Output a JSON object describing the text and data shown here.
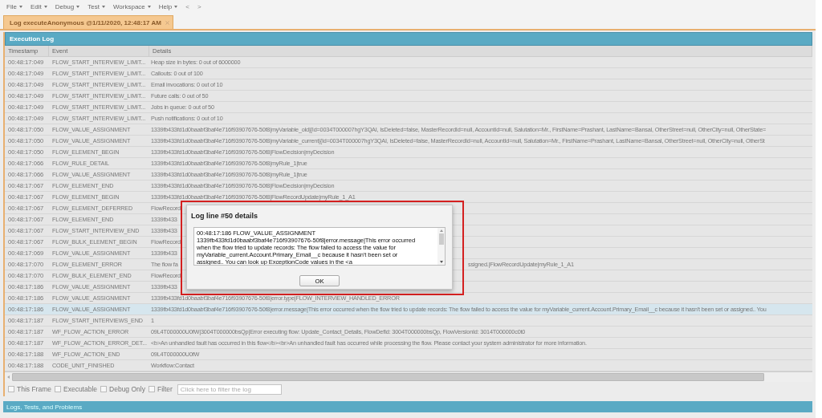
{
  "menu": [
    {
      "label": "File"
    },
    {
      "label": "Edit"
    },
    {
      "label": "Debug"
    },
    {
      "label": "Test"
    },
    {
      "label": "Workspace"
    },
    {
      "label": "Help"
    }
  ],
  "nav_buttons": [
    {
      "label": "<",
      "disabled": true
    },
    {
      "label": ">",
      "disabled": true
    }
  ],
  "tab": {
    "label": "Log executeAnonymous @1/11/2020, 12:48:17 AM",
    "selected": true
  },
  "panel": {
    "title": "Execution Log"
  },
  "table": {
    "columns": [
      "Timestamp",
      "Event",
      "Details"
    ],
    "rows": [
      {
        "timestamp": "00:48:17:049",
        "event": "FLOW_START_INTERVIEW_LIMIT...",
        "details": "Heap size in bytes: 0 out of 6000000",
        "selected": false
      },
      {
        "timestamp": "00:48:17:049",
        "event": "FLOW_START_INTERVIEW_LIMIT...",
        "details": "Callouts: 0 out of 100",
        "selected": false
      },
      {
        "timestamp": "00:48:17:049",
        "event": "FLOW_START_INTERVIEW_LIMIT...",
        "details": "Email invocations: 0 out of 10",
        "selected": false
      },
      {
        "timestamp": "00:48:17:049",
        "event": "FLOW_START_INTERVIEW_LIMIT...",
        "details": "Future calls: 0 out of 50",
        "selected": false
      },
      {
        "timestamp": "00:48:17:049",
        "event": "FLOW_START_INTERVIEW_LIMIT...",
        "details": "Jobs in queue: 0 out of 50",
        "selected": false
      },
      {
        "timestamp": "00:48:17:049",
        "event": "FLOW_START_INTERVIEW_LIMIT...",
        "details": "Push notifications: 0 out of 10",
        "selected": false
      },
      {
        "timestamp": "00:48:17:050",
        "event": "FLOW_VALUE_ASSIGNMENT",
        "details": "1339fb433fd1d0baabf3baf4e716f93907676-50f8|myVariable_old|{Id=0034T000007hgY3QAI, IsDeleted=false, MasterRecordId=null, AccountId=null, Salutation=Mr., FirstName=Prashant, LastName=Bansal, OtherStreet=null, OtherCity=null, OtherState=",
        "selected": false
      },
      {
        "timestamp": "00:48:17:050",
        "event": "FLOW_VALUE_ASSIGNMENT",
        "details": "1339fb433fd1d0baabf3baf4e716f93907676-50f8|myVariable_current|{Id=0034T000007hgY3QAI, IsDeleted=false, MasterRecordId=null, AccountId=null, Salutation=Mr., FirstName=Prashant, LastName=Bansal, OtherStreet=null, OtherCity=null, OtherSt",
        "selected": false
      },
      {
        "timestamp": "00:48:17:050",
        "event": "FLOW_ELEMENT_BEGIN",
        "details": "1339fb433fd1d0baabf3baf4e716f93907676-50f8|FlowDecision|myDecision",
        "selected": false
      },
      {
        "timestamp": "00:48:17:066",
        "event": "FLOW_RULE_DETAIL",
        "details": "1339fb433fd1d0baabf3baf4e716f93907676-50f8|myRule_1|true",
        "selected": false
      },
      {
        "timestamp": "00:48:17:066",
        "event": "FLOW_VALUE_ASSIGNMENT",
        "details": "1339fb433fd1d0baabf3baf4e716f93907676-50f8|myRule_1|true",
        "selected": false
      },
      {
        "timestamp": "00:48:17:067",
        "event": "FLOW_ELEMENT_END",
        "details": "1339fb433fd1d0baabf3baf4e716f93907676-50f8|FlowDecision|myDecision",
        "selected": false
      },
      {
        "timestamp": "00:48:17:067",
        "event": "FLOW_ELEMENT_BEGIN",
        "details": "1339fb433fd1d0baabf3baf4e716f93907676-50f8|FlowRecordUpdate|myRule_1_A1",
        "selected": false
      },
      {
        "timestamp": "00:48:17:067",
        "event": "FLOW_ELEMENT_DEFERRED",
        "details": "FlowRecord",
        "selected": false
      },
      {
        "timestamp": "00:48:17:067",
        "event": "FLOW_ELEMENT_END",
        "details": "1339fb433",
        "selected": false
      },
      {
        "timestamp": "00:48:17:067",
        "event": "FLOW_START_INTERVIEW_END",
        "details": "1339fb433",
        "selected": false
      },
      {
        "timestamp": "00:48:17:067",
        "event": "FLOW_BULK_ELEMENT_BEGIN",
        "details": "FlowRecord",
        "selected": false
      },
      {
        "timestamp": "00:48:17:069",
        "event": "FLOW_VALUE_ASSIGNMENT",
        "details": "1339fb433",
        "selected": false
      },
      {
        "timestamp": "00:48:17:070",
        "event": "FLOW_ELEMENT_ERROR",
        "details": "The flow fa",
        "details_tail": "ssigned.|FlowRecordUpdate|myRule_1_A1",
        "selected": false
      },
      {
        "timestamp": "00:48:17:070",
        "event": "FLOW_BULK_ELEMENT_END",
        "details": "FlowRecord",
        "selected": false
      },
      {
        "timestamp": "00:48:17:186",
        "event": "FLOW_VALUE_ASSIGNMENT",
        "details": "1339fb433",
        "selected": false
      },
      {
        "timestamp": "00:48:17:186",
        "event": "FLOW_VALUE_ASSIGNMENT",
        "details": "1339fb433fd1d0baabf3baf4e716f93907676-50f8|error.type|FLOW_INTERVIEW_HANDLED_ERROR",
        "selected": false
      },
      {
        "timestamp": "00:48:17:186",
        "event": "FLOW_VALUE_ASSIGNMENT",
        "details": "1339fb433fd1d0baabf3baf4e716f93907676-50f8|error.message|This error occurred when the flow tried to update records: The flow failed to access the value for myVariable_current.Account.Primary_Email__c because it hasn't been set or assigned.. You",
        "selected": true
      },
      {
        "timestamp": "00:48:17:187",
        "event": "FLOW_START_INTERVIEWS_END",
        "details": "1",
        "selected": false
      },
      {
        "timestamp": "00:48:17:187",
        "event": "WF_FLOW_ACTION_ERROR",
        "details": "09L4T000000U0fW|3004T000000bsQp|Error executing flow: Update_Contact_Details, FlowDefId: 3004T000000bsQp, FlowVersionId: 3014T000000c0t0",
        "selected": false
      },
      {
        "timestamp": "00:48:17:187",
        "event": "WF_FLOW_ACTION_ERROR_DET...",
        "details": "<b>An unhandled fault has occurred in this flow</b><br>An unhandled fault has occurred while processing the flow. Please contact your system administrator for more information.",
        "selected": false
      },
      {
        "timestamp": "00:48:17:188",
        "event": "WF_FLOW_ACTION_END",
        "details": "09L4T000000U0fW",
        "selected": false
      },
      {
        "timestamp": "00:48:17:188",
        "event": "CODE_UNIT_FINISHED",
        "details": "Workflow:Contact",
        "selected": false
      }
    ]
  },
  "filters": [
    {
      "label": "This Frame",
      "checked": false
    },
    {
      "label": "Executable",
      "checked": false
    },
    {
      "label": "Debug Only",
      "checked": false
    },
    {
      "label": "Filter",
      "checked": false
    }
  ],
  "filter_field": {
    "placeholder": "Click here to filter the log"
  },
  "dialog": {
    "title": "Log line #50 details",
    "highlighted": true,
    "lines": [
      "00:48:17:186 FLOW_VALUE_ASSIGNMENT",
      "1339fb433fd1d0baabf3baf4e716f93907676-50f8|error.message|This error occurred",
      "when the flow tried to update records: The flow failed to access the value for",
      "myVariable_current.Account.Primary_Email__c because it hasn't been set or",
      "assigned.. You can look up ExceptionCode values in the <a"
    ],
    "button": "OK"
  },
  "bottom_bar": {
    "title": "Logs, Tests, and Problems"
  }
}
